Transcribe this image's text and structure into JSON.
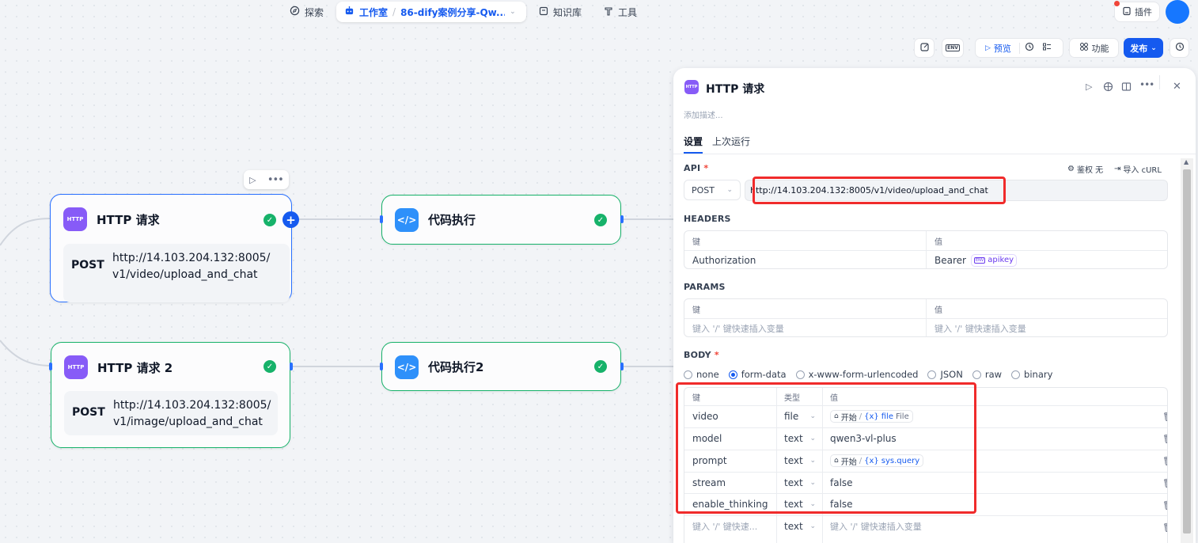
{
  "topnav": {
    "explore": "探索",
    "studio": "工作室",
    "app_name": "86-dify案例分享-Qw...",
    "knowledge": "知识库",
    "tools": "工具",
    "plugins": "插件"
  },
  "toolbar": {
    "preview": "预览",
    "features": "功能",
    "publish": "发布"
  },
  "canvas": {
    "nodes": [
      {
        "title": "HTTP 请求",
        "method": "POST",
        "url": "http://14.103.204.132:8005/ v1/video/upload_and_chat"
      },
      {
        "title": "代码执行"
      },
      {
        "title": "HTTP 请求 2",
        "method": "POST",
        "url": "http://14.103.204.132:8005/ v1/image/upload_and_chat"
      },
      {
        "title": "代码执行2"
      }
    ],
    "http_icon_label": "HTTP"
  },
  "panel": {
    "title": "HTTP 请求",
    "description_placeholder": "添加描述...",
    "tabs": [
      "设置",
      "上次运行"
    ],
    "api_label": "API",
    "auth_label": "鉴权 无",
    "import_curl": "导入 cURL",
    "method": "POST",
    "url": "http://14.103.204.132:8005/v1/video/upload_and_chat",
    "headers_label": "HEADERS",
    "headers": {
      "key_col": "键",
      "value_col": "值",
      "rows": [
        {
          "key": "Authorization",
          "value": "Bearer",
          "var": "apikey"
        }
      ]
    },
    "params_label": "PARAMS",
    "params": {
      "key_col": "键",
      "value_col": "值",
      "key_placeholder": "键入 '/' 键快速插入变量",
      "value_placeholder": "键入 '/' 键快速插入变量"
    },
    "body_label": "BODY",
    "body_types": [
      "none",
      "form-data",
      "x-www-form-urlencoded",
      "JSON",
      "raw",
      "binary"
    ],
    "body_selected": "form-data",
    "body": {
      "key_col": "键",
      "type_col": "类型",
      "value_col": "值",
      "rows": [
        {
          "key": "video",
          "type": "file",
          "value": "",
          "chip_node": "开始",
          "chip_var": "file",
          "chip_type": "File"
        },
        {
          "key": "model",
          "type": "text",
          "value": "qwen3-vl-plus"
        },
        {
          "key": "prompt",
          "type": "text",
          "value": "",
          "chip_node": "开始",
          "chip_var": "sys.query"
        },
        {
          "key": "stream",
          "type": "text",
          "value": "false"
        },
        {
          "key": "enable_thinking",
          "type": "text",
          "value": "false"
        }
      ],
      "new_row": {
        "key_placeholder": "键入 '/' 键快速...",
        "type": "text",
        "value_placeholder": "键入 '/' 键快速插入变量"
      }
    }
  }
}
